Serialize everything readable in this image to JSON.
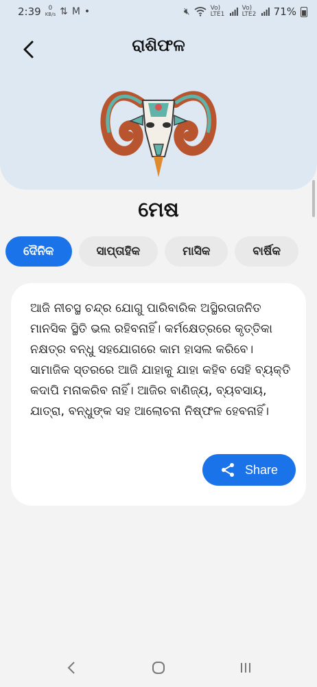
{
  "status_bar": {
    "time": "2:39",
    "net_speed": "0",
    "net_unit": "KB/s",
    "lte1": "Vo) LTE1",
    "lte2": "Vo) LTE2",
    "battery": "71%"
  },
  "header": {
    "title": "ରାଶିଫଳ",
    "back_icon": "chevron-left-icon"
  },
  "sign": {
    "name": "ମେଷ",
    "image": "aries-ram-illustration"
  },
  "tabs": [
    {
      "label": "ଦୈନିକ",
      "active": true
    },
    {
      "label": "ସାପ୍ତାହିକ",
      "active": false
    },
    {
      "label": "ମାସିକ",
      "active": false
    },
    {
      "label": "ବାର୍ଷିକ",
      "active": false
    }
  ],
  "horoscope": {
    "text": "ଆଜି ନୀଚସ୍ଥ ଚନ୍ଦ୍ର ଯୋଗୁ ପାରିବାରିକ ଅସ୍ଥିରତାଜନିତ ମାନସିକ ସ୍ଥିତି ଭଲ ରହିବନାହିଁ। କର୍ମକ୍ଷେତ୍ରରେ କୃତ୍ତିକା ନକ୍ଷତ୍ର ବନ୍ଧୁ ସହଯୋଗରେ କାମ ହାସଲ କରିବେ। ସାମାଜିକ ସ୍ତରରେ ଆଜି ଯାହାକୁ ଯାହା କହିବ ସେହି ବ୍ୟକ୍ତି କଦାପି ମନାକରିବ ନାହିଁ। ଆଜିର ବାଣିଜ୍ୟ, ବ୍ୟବସାୟ, ଯାତ୍ରା, ବନ୍ଧୁଙ୍କ ସହ ଆଲୋଚନା ନିଷ୍ଫଳ ହେବନାହିଁ।",
    "share_label": "Share",
    "share_icon": "share-icon"
  },
  "colors": {
    "accent": "#1a73e8",
    "header_bg": "#dde8f3",
    "page_bg": "#f3f3f3"
  },
  "navbar": {
    "back_icon": "nav-back-icon",
    "home_icon": "nav-home-icon",
    "recents_icon": "nav-recents-icon"
  }
}
